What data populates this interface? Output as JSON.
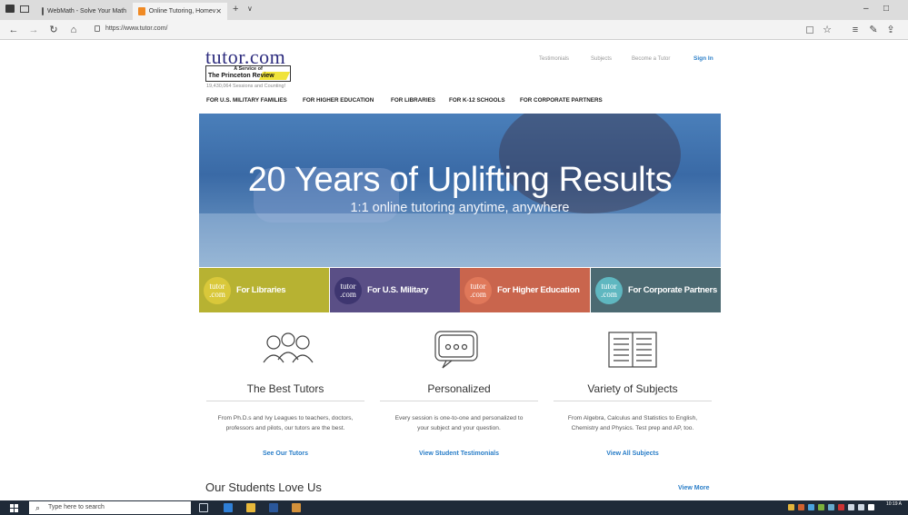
{
  "browser": {
    "tabs": [
      {
        "label": "WebMath - Solve Your Math",
        "active": false
      },
      {
        "label": "Online Tutoring, Homev",
        "active": true
      }
    ],
    "url": "https://www.tutor.com/",
    "icons": {
      "back": "arrow-left",
      "forward": "arrow-right",
      "refresh": "refresh",
      "home": "home",
      "lock": "lock",
      "favorite": "star",
      "favorites_bar": "favorites-list",
      "notes": "pen",
      "share": "share"
    },
    "window_controls": {
      "minimize": "–",
      "maximize": "□"
    }
  },
  "header": {
    "logo_word": "tutor.com",
    "logo_service": "A Service of",
    "logo_brand": "The Princeton Review",
    "sessions_text": "19,430,064 Sessions and Counting!",
    "top_links": [
      "Testimonials",
      "Subjects",
      "Become a Tutor"
    ],
    "signin": "Sign In",
    "nav": [
      "FOR U.S. MILITARY FAMILIES",
      "FOR HIGHER EDUCATION",
      "FOR LIBRARIES",
      "FOR K-12 SCHOOLS",
      "FOR CORPORATE PARTNERS"
    ]
  },
  "hero": {
    "title": "20 Years of Uplifting Results",
    "subtitle": "1:1 online tutoring anytime, anywhere"
  },
  "tiles": [
    {
      "badge_top": "tutor",
      "badge_bottom": ".com",
      "label": "For Libraries",
      "bg": "#b7b232",
      "badge": "#d9c83a"
    },
    {
      "badge_top": "tutor",
      "badge_bottom": ".com",
      "label": "For U.S. Military",
      "bg": "#5a4f86",
      "badge": "#3e3670"
    },
    {
      "badge_top": "tutor",
      "badge_bottom": ".com",
      "label": "For Higher Education",
      "bg": "#c9654d",
      "badge": "#e0785a"
    },
    {
      "badge_top": "tutor",
      "badge_bottom": ".com",
      "label": "For Corporate Partners",
      "bg": "#4c6a72",
      "badge": "#5fb7c0"
    }
  ],
  "features": [
    {
      "icon": "people-icon",
      "title": "The Best Tutors",
      "desc": "From Ph.D.s and Ivy Leagues to teachers, doctors, professors and pilots, our tutors are the best.",
      "link": "See Our Tutors"
    },
    {
      "icon": "chat-bubble-icon",
      "title": "Personalized",
      "desc": "Every session is one-to-one and personalized to your subject and your question.",
      "link": "View Student Testimonials"
    },
    {
      "icon": "book-icon",
      "title": "Variety of Subjects",
      "desc": "From Algebra, Calculus and Statistics to English, Chemistry and Physics. Test prep and AP, too.",
      "link": "View All Subjects"
    }
  ],
  "testimonials": {
    "heading": "Our Students Love Us",
    "view_more": "View More"
  },
  "taskbar": {
    "search_placeholder": "Type here to search",
    "clock": "10:19 A"
  },
  "colors": {
    "brand_navy": "#2e2d7f",
    "link_blue": "#2a7ec8",
    "highlight_yellow": "#f0e33a"
  }
}
